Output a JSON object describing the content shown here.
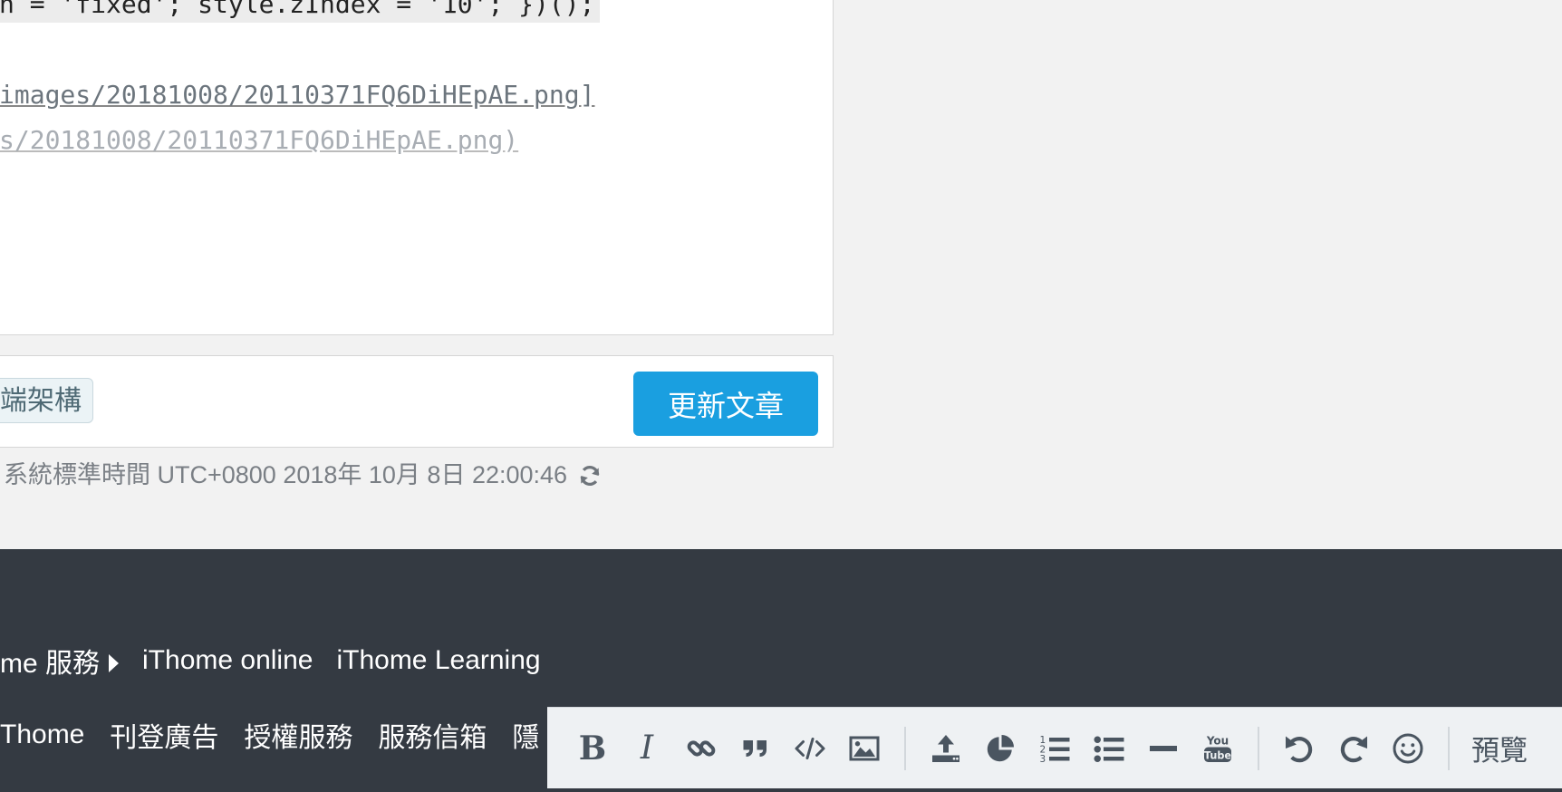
{
  "editor": {
    "lines": [
      "n = 'fixed'; style.zIndex = '10'; })();",
      "images/20181008/20110371FQ6DiHEpAE.png]",
      "s/20181008/20110371FQ6DiHEpAE.png)"
    ]
  },
  "action_bar": {
    "tag": "端架構",
    "update_label": "更新文章"
  },
  "timestamp": {
    "text": "系統標準時間 UTC+0800 2018年 10月 8日 22:00:46"
  },
  "footer": {
    "row1": [
      "me 服務",
      "iThome online",
      "iThome Learning"
    ],
    "row2": [
      "Thome",
      "刊登廣告",
      "授權服務",
      "服務信箱",
      "隱"
    ]
  },
  "toolbar": {
    "buttons": [
      {
        "icon": "bold-icon"
      },
      {
        "icon": "italic-icon"
      },
      {
        "icon": "link-icon"
      },
      {
        "icon": "quote-icon"
      },
      {
        "icon": "code-icon"
      },
      {
        "icon": "image-icon"
      },
      {
        "icon": "upload-icon"
      },
      {
        "icon": "pie-chart-icon"
      },
      {
        "icon": "ordered-list-icon"
      },
      {
        "icon": "unordered-list-icon"
      },
      {
        "icon": "horizontal-rule-icon"
      },
      {
        "icon": "youtube-icon"
      },
      {
        "icon": "undo-icon"
      },
      {
        "icon": "redo-icon"
      },
      {
        "icon": "emoji-icon"
      }
    ],
    "bold_glyph": "B",
    "italic_glyph": "I",
    "youtube_top": "You",
    "youtube_bottom": "Tube",
    "preview_label": "預覽"
  },
  "colors": {
    "accent": "#1a9fe0",
    "footer_bg": "#343a42",
    "page_bg": "#f2f2f2",
    "toolbar_bg": "#eef1f3"
  }
}
